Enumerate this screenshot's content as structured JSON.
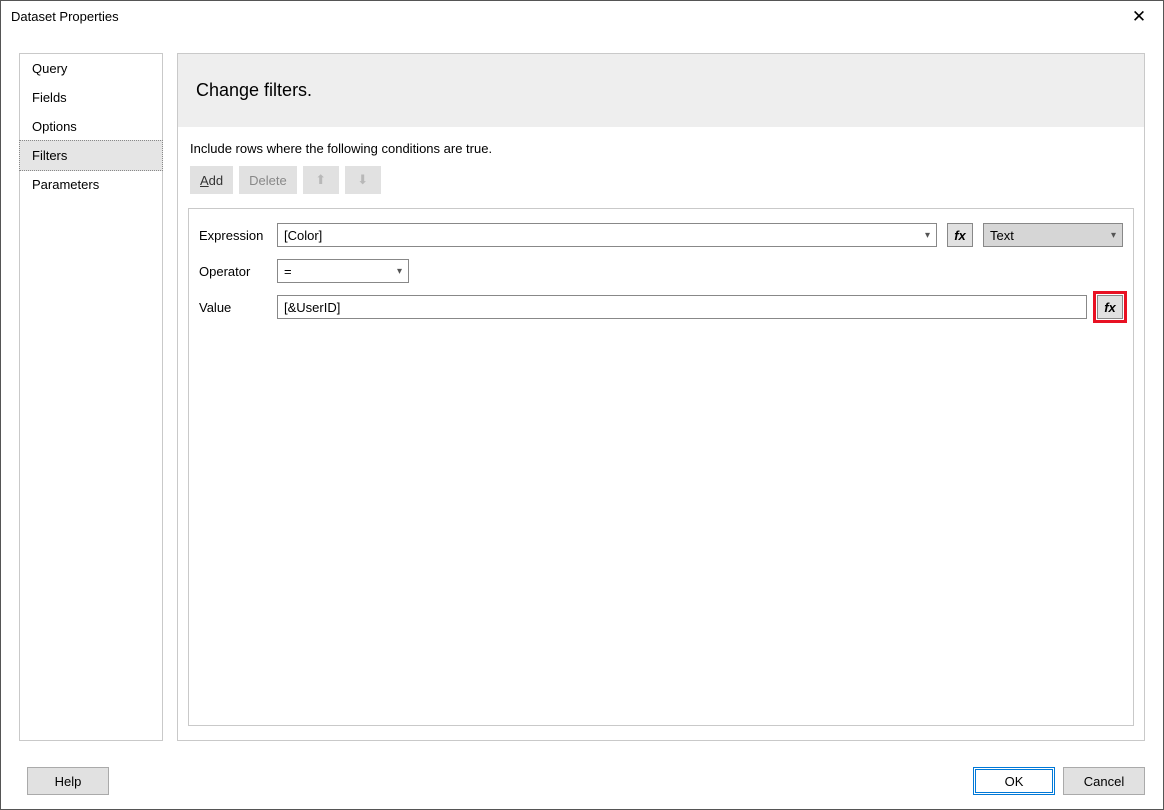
{
  "window": {
    "title": "Dataset Properties"
  },
  "sidebar": {
    "items": [
      {
        "label": "Query"
      },
      {
        "label": "Fields"
      },
      {
        "label": "Options"
      },
      {
        "label": "Filters"
      },
      {
        "label": "Parameters"
      }
    ],
    "selectedIndex": 3
  },
  "main": {
    "heading": "Change filters.",
    "instruction": "Include rows where the following conditions are true.",
    "toolbar": {
      "add": "Add",
      "delete": "Delete"
    },
    "filter": {
      "expressionLabel": "Expression",
      "expressionValue": "[Color]",
      "typeValue": "Text",
      "operatorLabel": "Operator",
      "operatorValue": "=",
      "valueLabel": "Value",
      "valueValue": "[&UserID]"
    }
  },
  "footer": {
    "help": "Help",
    "ok": "OK",
    "cancel": "Cancel"
  },
  "fx": "fx"
}
